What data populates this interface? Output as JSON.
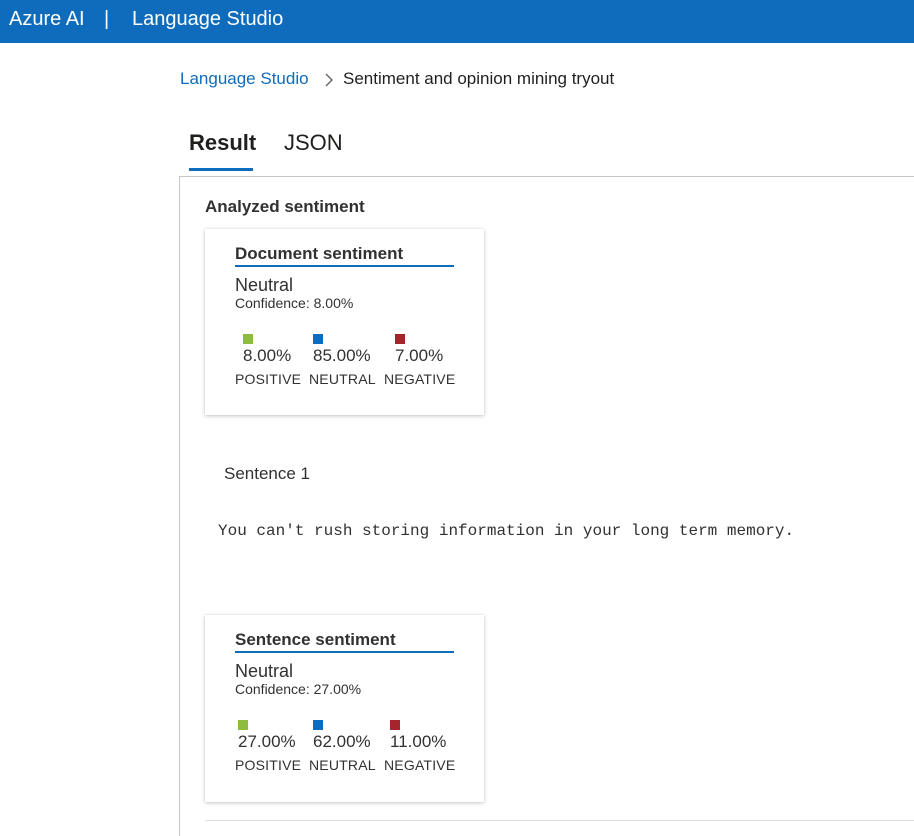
{
  "header": {
    "brand": "Azure AI",
    "separator": "|",
    "product": "Language Studio"
  },
  "breadcrumb": {
    "root": "Language Studio",
    "current": "Sentiment and opinion mining tryout"
  },
  "tabs": [
    {
      "label": "Result",
      "active": true
    },
    {
      "label": "JSON",
      "active": false
    }
  ],
  "analyzed_title": "Analyzed sentiment",
  "document_card": {
    "title": "Document sentiment",
    "label": "Neutral",
    "confidence": "Confidence: 8.00%",
    "metrics": [
      {
        "value": "8.00%",
        "label": "POSITIVE",
        "color": "#8cbd3f"
      },
      {
        "value": "85.00%",
        "label": "NEUTRAL",
        "color": "#0f6cbd"
      },
      {
        "value": "7.00%",
        "label": "NEGATIVE",
        "color": "#a4262c"
      }
    ]
  },
  "sentence": {
    "label": "Sentence 1",
    "text": "You can't rush storing information in your long term memory."
  },
  "sentence_card": {
    "title": "Sentence sentiment",
    "label": "Neutral",
    "confidence": "Confidence: 27.00%",
    "metrics": [
      {
        "value": "27.00%",
        "label": "POSITIVE",
        "color": "#8cbd3f"
      },
      {
        "value": "62.00%",
        "label": "NEUTRAL",
        "color": "#0f6cbd"
      },
      {
        "value": "11.00%",
        "label": "NEGATIVE",
        "color": "#a4262c"
      }
    ]
  }
}
